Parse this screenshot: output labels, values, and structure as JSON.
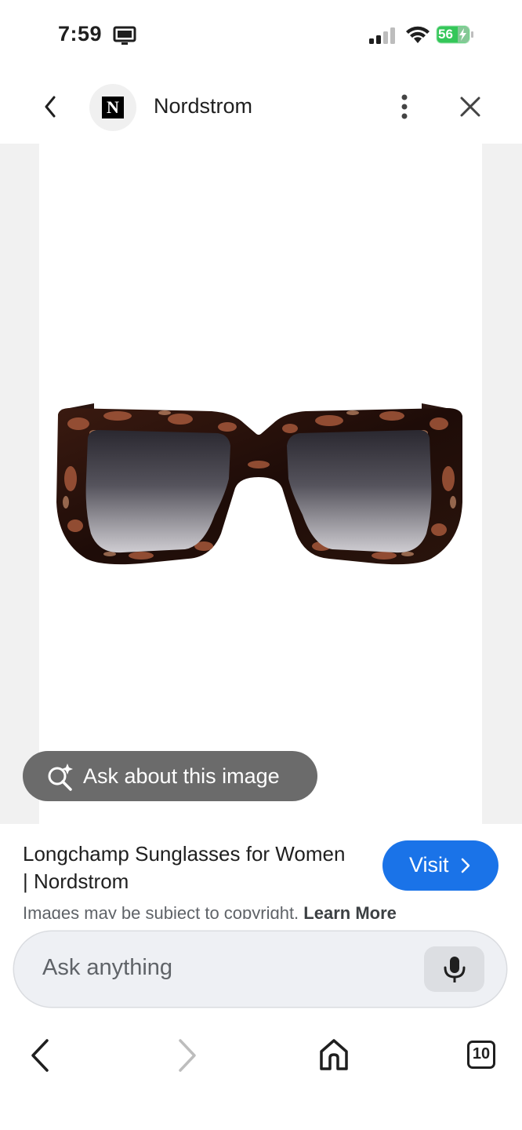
{
  "status_bar": {
    "time": "7:59",
    "battery": "56"
  },
  "header": {
    "site_logo_letter": "N",
    "site_name": "Nordstrom"
  },
  "image_overlay": {
    "ask_label": "Ask about this image"
  },
  "product": {
    "title": "Longchamp Sunglasses for Women | Nordstrom",
    "visit_label": "Visit",
    "copyright_text": "Images may be subject to copyright.",
    "learn_more_label": "Learn More"
  },
  "search": {
    "placeholder": "Ask anything"
  },
  "bottom_nav": {
    "tabs_count": "10"
  },
  "colors": {
    "accent": "#1a73e8",
    "battery_green": "#34c759",
    "overlay_button": "#6b6b6b"
  },
  "icons": [
    "monitor-icon",
    "signal-icon",
    "wifi-icon",
    "battery-icon",
    "back-icon",
    "more-vertical-icon",
    "close-icon",
    "sparkle-search-icon",
    "chevron-right-icon",
    "mic-icon",
    "forward-icon",
    "home-icon",
    "tabs-icon"
  ]
}
